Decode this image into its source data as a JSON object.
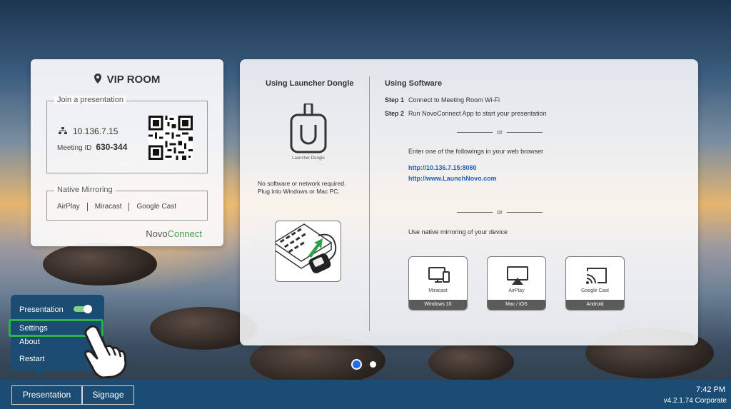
{
  "vip_card": {
    "title": "VIP ROOM",
    "join_legend": "Join a presentation",
    "ip": "10.136.7.15",
    "meeting_id_label": "Meeting ID",
    "meeting_id": "630-344",
    "mirror_legend": "Native Mirroring",
    "mirror_methods": [
      "AirPlay",
      "Miracast",
      "Google Cast"
    ],
    "brand_a": "Novo",
    "brand_b": "Connect"
  },
  "main_card": {
    "dongle_heading": "Using Launcher Dongle",
    "dongle_caption": "Launcher Dongle",
    "dongle_desc_1": "No software or network required.",
    "dongle_desc_2": "Plug into Windows or Mac PC.",
    "software_heading": "Using Software",
    "step1_label": "Step 1",
    "step1_text": "Connect to Meeting Room Wi-Fi",
    "step2_label": "Step 2",
    "step2_text": "Run NovoConnect App to start your presentation",
    "or": "or",
    "browser_note": "Enter one of the followings in your web browser",
    "link1": "http://10.136.7.15:8080",
    "link2": "http://www.LaunchNovo.com",
    "mirror_note": "Use native mirroring of your device",
    "devices": [
      {
        "name": "Miracast",
        "os": "Windows 10",
        "icon": "monitor-phone-icon"
      },
      {
        "name": "AirPlay",
        "os": "Mac / iOS",
        "icon": "airplay-icon"
      },
      {
        "name": "Google Cast",
        "os": "Android",
        "icon": "cast-icon"
      }
    ]
  },
  "menu": {
    "items": [
      "Presentation",
      "Settings",
      "About",
      "Restart"
    ],
    "presentation_toggle": "on"
  },
  "bottombar": {
    "tabs": [
      "Presentation",
      "Signage"
    ],
    "time": "7:42 PM",
    "version": "v4.2.1.74 Corporate"
  },
  "pager": {
    "pages": 2,
    "active": 1
  },
  "colors": {
    "accent_green": "#3fa34d",
    "bar_blue": "#1b4c74",
    "link_blue": "#1f5fbf",
    "dot_active": "#1e6ee8"
  }
}
